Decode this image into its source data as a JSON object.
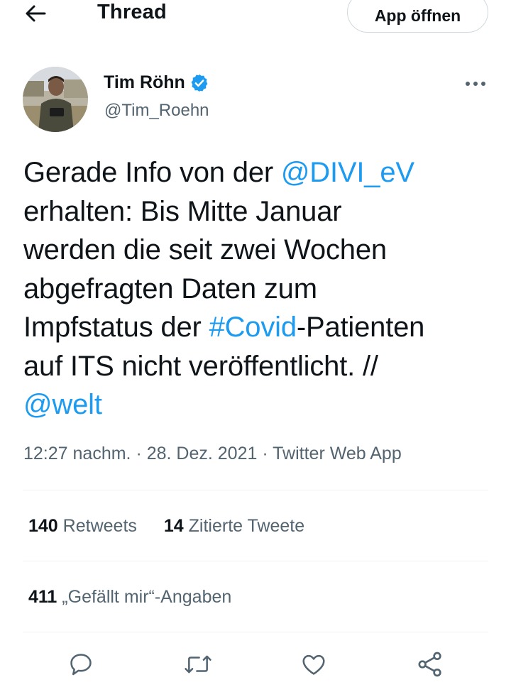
{
  "header": {
    "back_icon": "arrow-left-icon",
    "title": "Thread",
    "open_app_label": "App öffnen"
  },
  "tweet": {
    "author": {
      "name": "Tim Röhn",
      "handle": "@Tim_Roehn",
      "verified_icon": "verified-badge-icon",
      "verified_color": "#1d9bf0"
    },
    "more_icon": "more-horizontal-icon",
    "text_parts": {
      "l1_pre": "Gerade Info von der ",
      "l1_mention": "@DIVI_eV",
      "l2": "erhalten: Bis Mitte Januar",
      "l3": "werden die seit zwei Wochen",
      "l4": "abgefragten Daten zum",
      "l5_pre": "Impfstatus der ",
      "l5_hashtag": "#Covid",
      "l5_post": "-Patienten",
      "l6": "auf ITS nicht veröffentlicht. //",
      "l7_mention": "@welt"
    },
    "link_color": "#1d9bf0",
    "meta": {
      "time": "12:27 nachm.",
      "sep1": " · ",
      "date": "28. Dez. 2021",
      "sep2": " · ",
      "source": "Twitter Web App"
    },
    "stats": {
      "retweets_count": "140",
      "retweets_label": "Retweets",
      "quotes_count": "14",
      "quotes_label": "Zitierte Tweete",
      "likes_count": "411",
      "likes_label": "„Gefällt mir“-Angaben"
    },
    "actions": [
      "reply-icon",
      "retweet-icon",
      "like-icon",
      "share-icon"
    ]
  }
}
